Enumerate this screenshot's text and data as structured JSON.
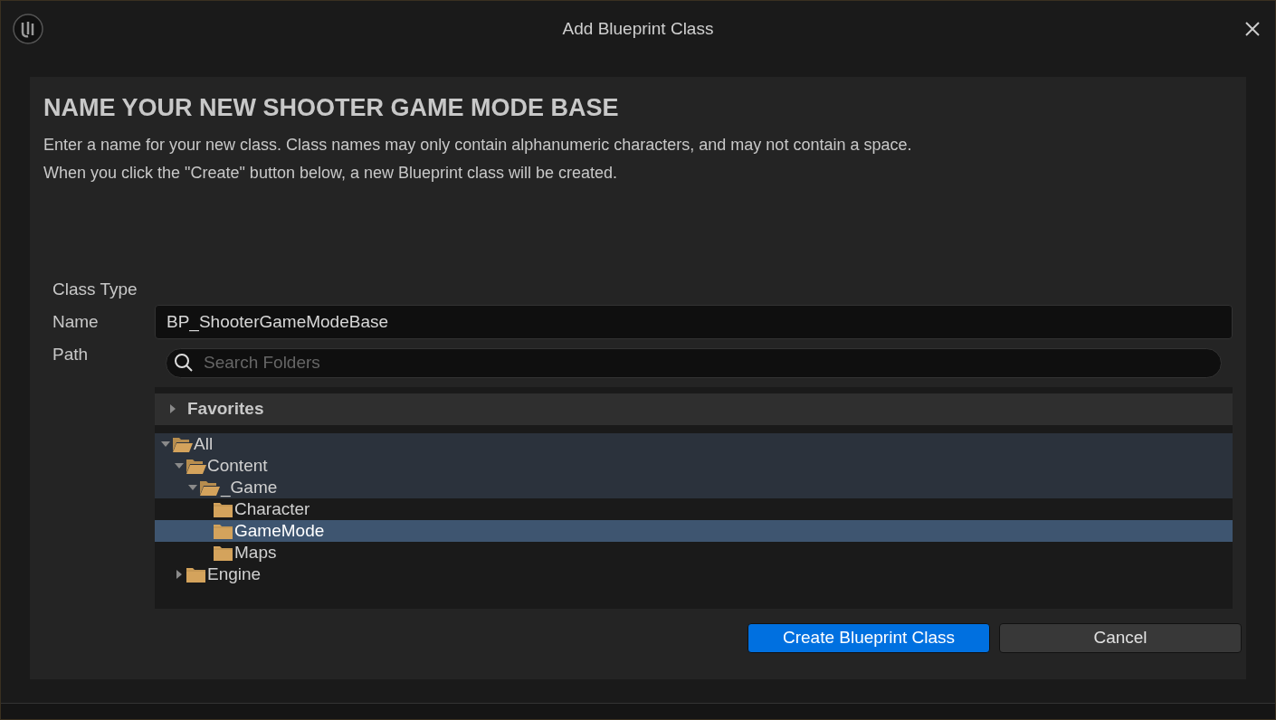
{
  "window": {
    "title": "Add Blueprint Class"
  },
  "heading": "NAME YOUR NEW SHOOTER GAME MODE BASE",
  "description": [
    "Enter a name for your new class. Class names may only contain alphanumeric characters, and may not contain a space.",
    "When you click the \"Create\" button below, a new Blueprint class will be created."
  ],
  "labels": [
    "Class Type",
    "Name",
    "Path"
  ],
  "name_field": {
    "value": "BP_ShooterGameModeBase"
  },
  "search": {
    "placeholder": "Search Folders"
  },
  "favorites": {
    "label": "Favorites",
    "expanded": false
  },
  "tree": [
    {
      "label": "All",
      "expanded": true,
      "selected": false,
      "children": [
        {
          "label": "Content",
          "expanded": true,
          "selected": false,
          "children": [
            {
              "label": "_Game",
              "expanded": true,
              "selected": false,
              "children": [
                {
                  "label": "Character",
                  "selected": false
                },
                {
                  "label": "GameMode",
                  "selected": true
                },
                {
                  "label": "Maps",
                  "selected": false
                }
              ]
            }
          ]
        },
        {
          "label": "Engine",
          "expanded": false,
          "selected": false
        }
      ]
    }
  ],
  "buttons": [
    {
      "label": "Create Blueprint Class",
      "kind": "primary"
    },
    {
      "label": "Cancel",
      "kind": "secondary"
    }
  ]
}
